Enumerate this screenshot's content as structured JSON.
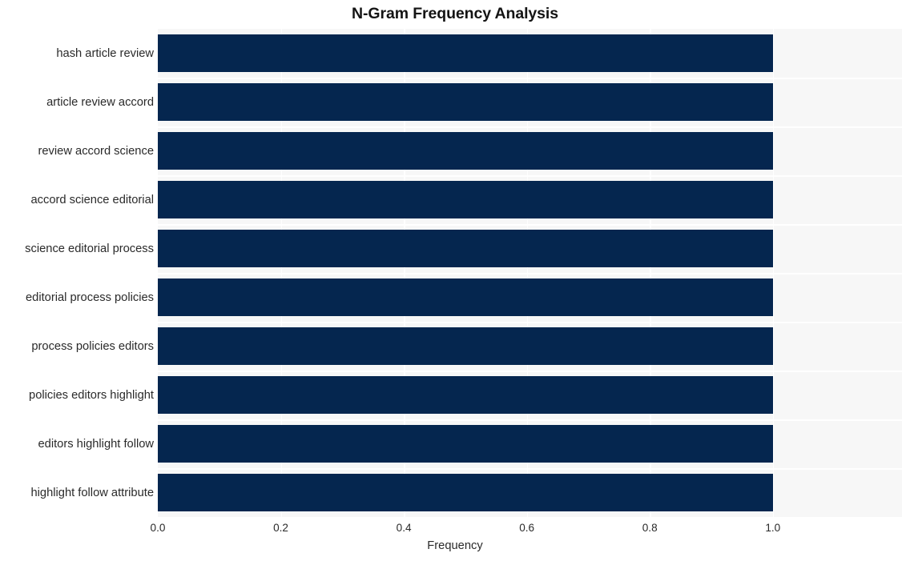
{
  "chart_data": {
    "type": "bar",
    "orientation": "horizontal",
    "title": "N-Gram Frequency Analysis",
    "xlabel": "Frequency",
    "ylabel": "",
    "categories": [
      "hash article review",
      "article review accord",
      "review accord science",
      "accord science editorial",
      "science editorial process",
      "editorial process policies",
      "process policies editors",
      "policies editors highlight",
      "editors highlight follow",
      "highlight follow attribute"
    ],
    "values": [
      1.0,
      1.0,
      1.0,
      1.0,
      1.0,
      1.0,
      1.0,
      1.0,
      1.0,
      1.0
    ],
    "xlim": [
      0.0,
      1.21
    ],
    "xticks": [
      0.0,
      0.2,
      0.4,
      0.6,
      0.8,
      1.0
    ],
    "xtick_labels": [
      "0.0",
      "0.2",
      "0.4",
      "0.6",
      "0.8",
      "1.0"
    ],
    "grid": true,
    "legend": null,
    "bar_color": "#05264f",
    "plot_background": "#f7f7f7",
    "grid_color": "#ffffff",
    "figure_background": "#ffffff",
    "title_color": "#141414",
    "tick_label_color": "#2a2a2a"
  }
}
